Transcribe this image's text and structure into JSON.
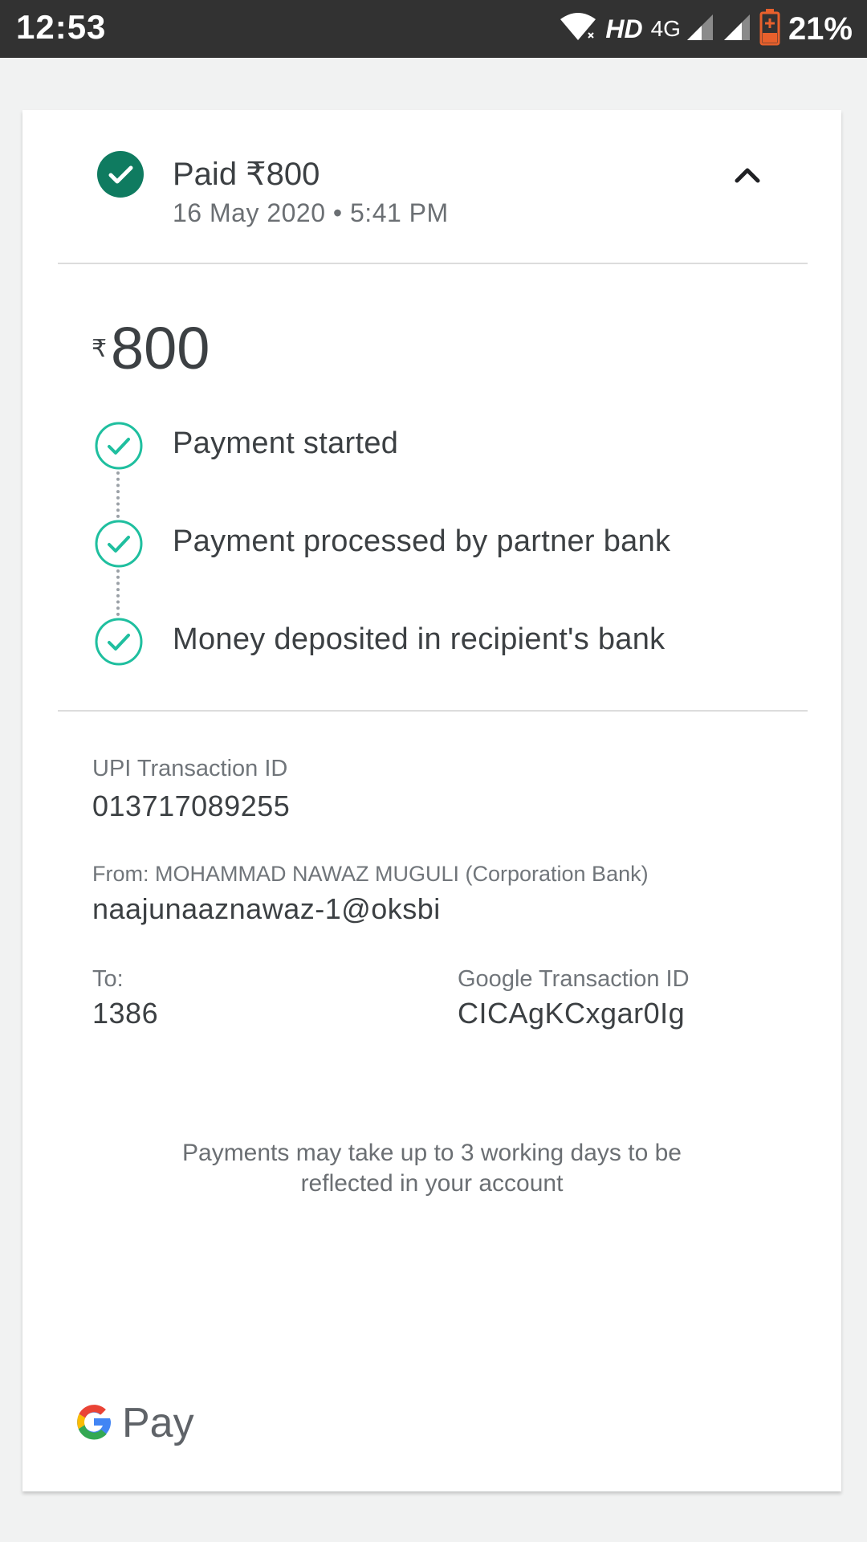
{
  "status_bar": {
    "time": "12:53",
    "hd_label": "HD",
    "network_label": "4G",
    "battery_percent": "21%"
  },
  "header": {
    "title": "Paid ₹800",
    "subtitle": "16 May 2020 • 5:41 PM"
  },
  "amount": {
    "currency": "₹",
    "value": "800"
  },
  "steps": [
    {
      "label": "Payment started"
    },
    {
      "label": "Payment processed by partner bank"
    },
    {
      "label": "Money deposited in recipient's bank"
    }
  ],
  "details": {
    "upi_label": "UPI Transaction ID",
    "upi_value": "013717089255",
    "from_label": "From: MOHAMMAD NAWAZ   MUGULI (Corporation Bank)",
    "from_value": "naajunaaznawaz-1@oksbi",
    "to_label": "To:",
    "to_value": "1386",
    "google_label": "Google Transaction ID",
    "google_value": "CICAgKCxgar0Ig"
  },
  "notice": {
    "line1": "Payments may take up to 3 working days to be",
    "line2": "reflected in your account"
  },
  "footer": {
    "logo_text": "Pay"
  },
  "colors": {
    "success_green": "#0f7b60",
    "step_teal": "#1fbf9f",
    "status_bar": "#323232"
  }
}
